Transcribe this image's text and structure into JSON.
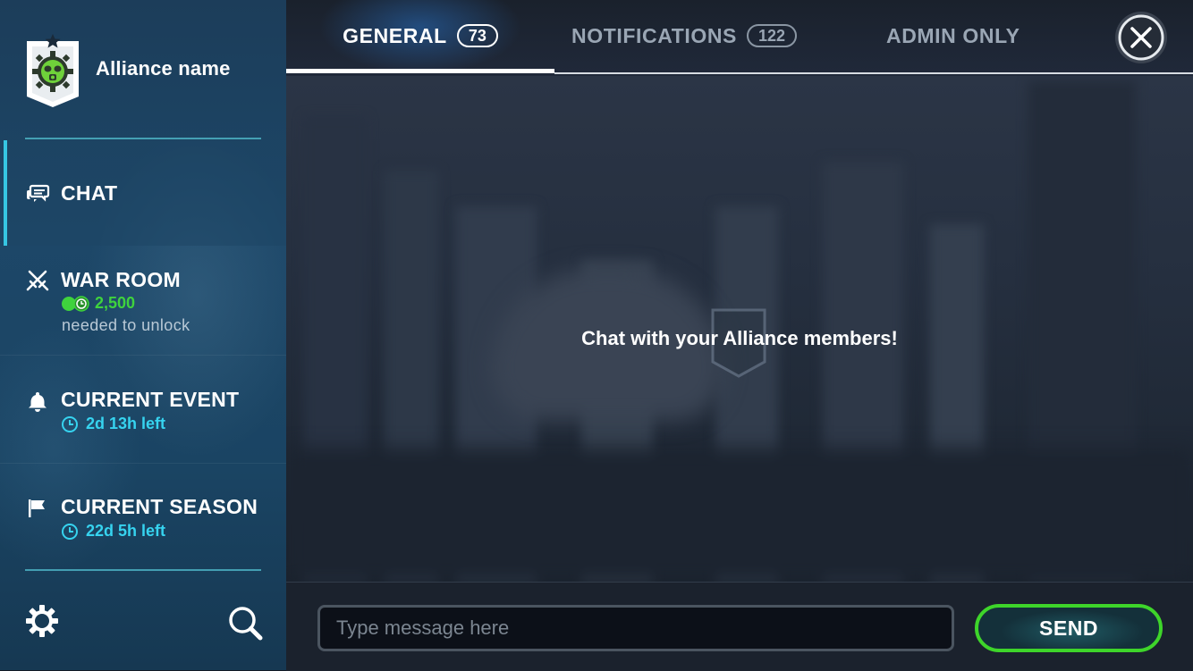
{
  "alliance": {
    "name": "Alliance name"
  },
  "sidebar": {
    "chat": {
      "label": "CHAT"
    },
    "war_room": {
      "label": "WAR ROOM",
      "cost": "2,500",
      "unlock_text": "needed to unlock"
    },
    "current_event": {
      "label": "CURRENT EVENT",
      "time_left": "2d 13h left"
    },
    "current_season": {
      "label": "CURRENT SEASON",
      "time_left": "22d 5h left"
    }
  },
  "tabs": [
    {
      "label": "GENERAL",
      "badge": "73"
    },
    {
      "label": "NOTIFICATIONS",
      "badge": "122"
    },
    {
      "label": "ADMIN ONLY"
    }
  ],
  "empty_state": {
    "message": "Chat with your Alliance members!"
  },
  "composer": {
    "placeholder": "Type message here",
    "value": "",
    "send_label": "SEND"
  },
  "colors": {
    "accent_cyan": "#36d3ef",
    "cost_green": "#3fd33d",
    "send_border": "#3ed52a",
    "active_bar": "#36c6e3"
  },
  "icons": {
    "alliance_emblem": "gas-mask-badge-icon",
    "chat": "chat-bubbles-icon",
    "war_room": "crossed-swords-icon",
    "event": "bell-icon",
    "season": "flag-icon",
    "timer": "clock-icon",
    "currency": "coin-clock-icon",
    "settings": "gear-icon",
    "search": "search-icon",
    "close": "close-icon"
  }
}
